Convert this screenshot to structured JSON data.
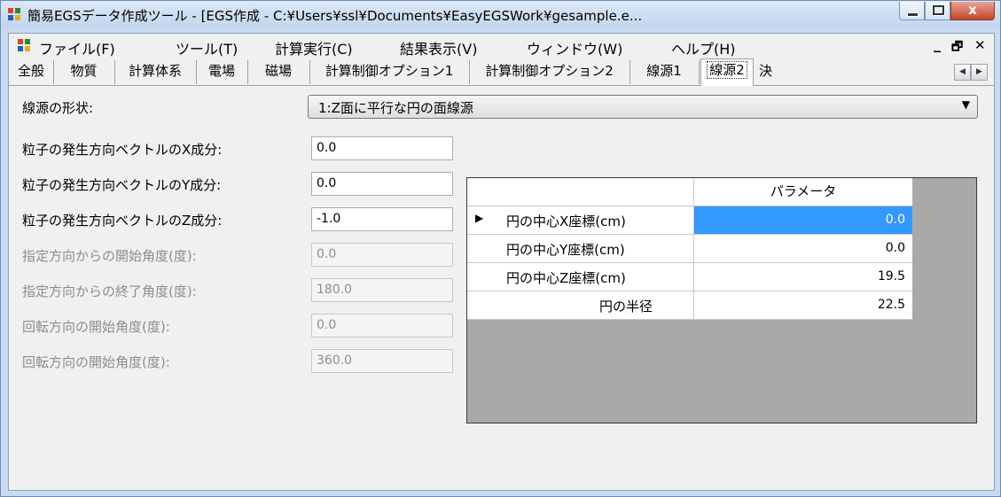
{
  "window": {
    "title": "簡易EGSデータ作成ツール - [EGS作成 - C:¥Users¥ssl¥Documents¥EasyEGSWork¥gesample.e...",
    "close_label": "x"
  },
  "menu": {
    "items": [
      "ファイル(F)",
      "ツール(T)",
      "計算実行(C)",
      "結果表示(V)",
      "ウィンドウ(W)",
      "ヘルプ(H)"
    ],
    "mdi_min": "_",
    "mdi_restore": "🗗",
    "mdi_close": "✕"
  },
  "tabs": {
    "items": [
      "全般",
      "物質",
      "計算体系",
      "電場",
      "磁場",
      "計算制御オプション1",
      "計算制御オプション2",
      "線源1",
      "線源2",
      "決"
    ],
    "active_index": 8
  },
  "source": {
    "shape_label": "線源の形状:",
    "shape_value": "1:Z面に平行な円の面線源"
  },
  "fields": [
    {
      "label": "粒子の発生方向ベクトルのX成分:",
      "value": "0.0",
      "enabled": true
    },
    {
      "label": "粒子の発生方向ベクトルのY成分:",
      "value": "0.0",
      "enabled": true
    },
    {
      "label": "粒子の発生方向ベクトルのZ成分:",
      "value": "-1.0",
      "enabled": true
    },
    {
      "label": "指定方向からの開始角度(度):",
      "value": "0.0",
      "enabled": false
    },
    {
      "label": "指定方向からの終了角度(度):",
      "value": "180.0",
      "enabled": false
    },
    {
      "label": "回転方向の開始角度(度):",
      "value": "0.0",
      "enabled": false
    },
    {
      "label": "回転方向の開始角度(度):",
      "value": "360.0",
      "enabled": false
    }
  ],
  "grid": {
    "header": "パラメータ",
    "rows": [
      {
        "name": "円の中心X座標(cm)",
        "value": "0.0",
        "selected": true
      },
      {
        "name": "円の中心Y座標(cm)",
        "value": "0.0",
        "selected": false
      },
      {
        "name": "円の中心Z座標(cm)",
        "value": "19.5",
        "selected": false
      },
      {
        "name": "円の半径",
        "value": "22.5",
        "selected": false
      }
    ],
    "current_row_marker": "▶"
  },
  "colors": {
    "selection": "#3399ff",
    "grid_background": "#a9a9a9",
    "close_button": "#c5452c"
  }
}
